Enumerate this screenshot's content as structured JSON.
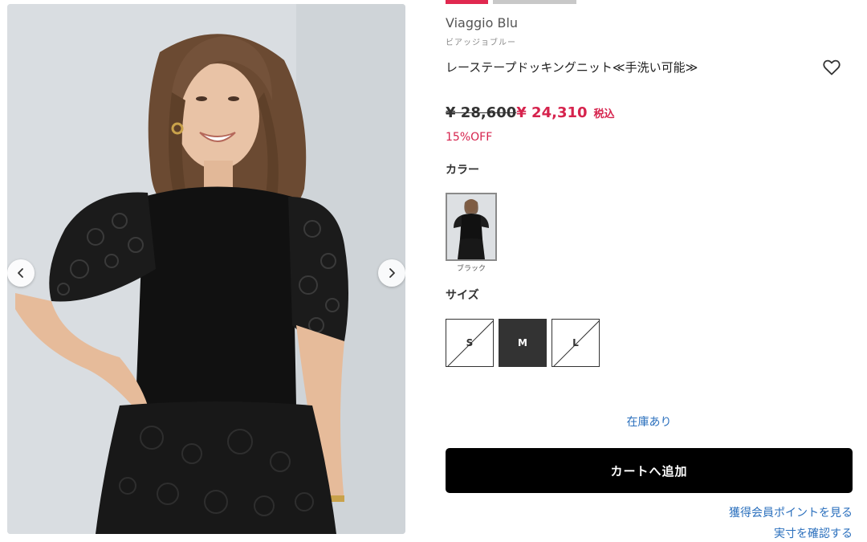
{
  "gallery": {
    "prev_icon": "chevron-left-icon",
    "next_icon": "chevron-right-icon"
  },
  "product": {
    "brand": "Viaggio Blu",
    "brand_kana": "ビアッジョブルー",
    "title": "レーステープドッキングニット≪手洗い可能≫",
    "favorite_icon": "heart-outline-icon",
    "price_original": "¥ 28,600",
    "price_sale": "¥ 24,310",
    "tax_label": "税込",
    "discount": "15%OFF"
  },
  "color": {
    "label": "カラー",
    "options": [
      {
        "name": "ブラック",
        "selected": true
      }
    ]
  },
  "size": {
    "label": "サイズ",
    "options": [
      {
        "name": "S",
        "available": false,
        "selected": false
      },
      {
        "name": "M",
        "available": true,
        "selected": true
      },
      {
        "name": "L",
        "available": false,
        "selected": false
      }
    ]
  },
  "stock_status": "在庫あり",
  "cart_button_label": "カートへ追加",
  "links": {
    "points": "獲得会員ポイントを見る",
    "measurements": "実寸を確認する"
  },
  "colors": {
    "accent_red": "#d6234d",
    "link_blue": "#2a6fbd",
    "cart_button": "#000000",
    "selected_size": "#333333"
  }
}
